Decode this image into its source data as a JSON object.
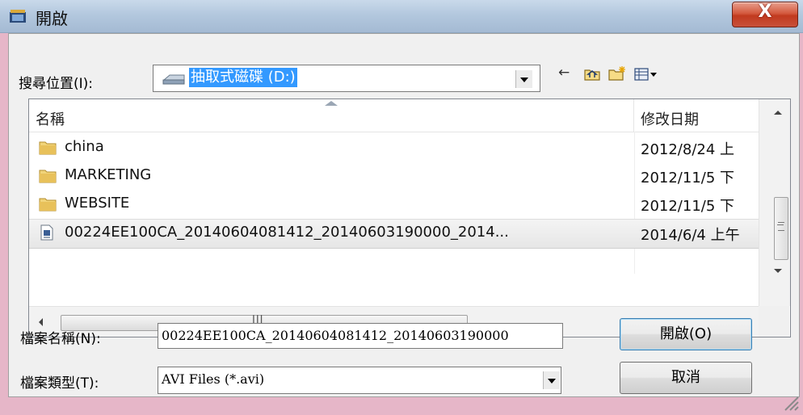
{
  "window": {
    "title": "開啟"
  },
  "toolbar": {
    "look_in_label": "搜尋位置(I):",
    "location": "抽取式磁碟 (D:)",
    "back_icon": "back-arrow-icon",
    "up_icon": "up-folder-icon",
    "new_folder_icon": "new-folder-icon",
    "view_icon": "view-menu-icon"
  },
  "file_list": {
    "columns": [
      "名稱",
      "修改日期"
    ],
    "rows": [
      {
        "name": "china",
        "date": "2012/8/24 上",
        "type": "folder"
      },
      {
        "name": "MARKETING",
        "date": "2012/11/5 下",
        "type": "folder"
      },
      {
        "name": "WEBSITE",
        "date": "2012/11/5 下",
        "type": "folder"
      },
      {
        "name": "00224EE100CA_20140604081412_20140603190000_2014...",
        "date": "2014/6/4 上午",
        "type": "file"
      }
    ],
    "hscroll_thumb_glyph": "III"
  },
  "filename": {
    "label": "檔案名稱(N):",
    "value": "00224EE100CA_20140604081412_20140603190000"
  },
  "filetype": {
    "label": "檔案類型(T):",
    "value": "AVI Files (*.avi)"
  },
  "buttons": {
    "open": "開啟(O)",
    "cancel": "取消"
  },
  "colors": {
    "selection": "#3399ff",
    "close": "#c8503a"
  }
}
